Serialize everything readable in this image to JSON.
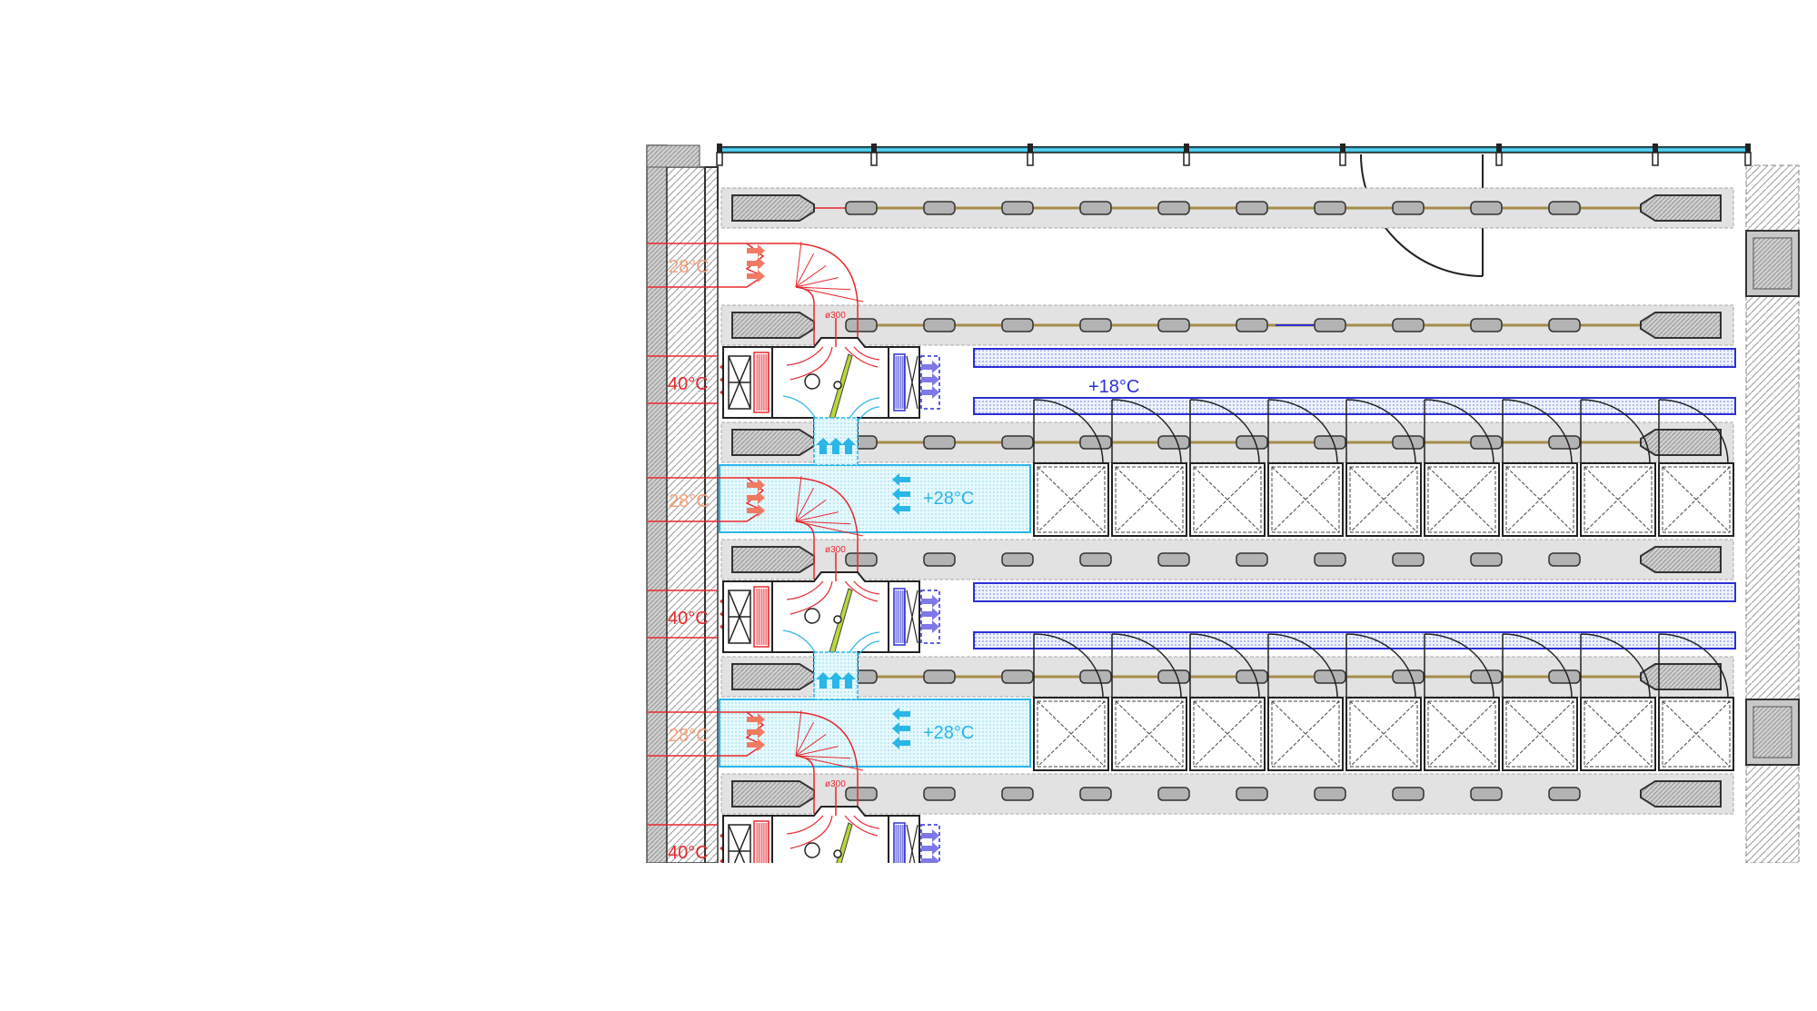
{
  "colors": {
    "hot": "#e8282d",
    "hot_light": "#f27a62",
    "warm": "#f2a07a",
    "cold": "#2b2fd6",
    "cyan": "#29b6e8",
    "cyan_fill": "#d8f4fb",
    "rack": "#e2e2e2",
    "lamp": "#b3b3b3",
    "cable": "#a58c4a",
    "window": "#5bd0ea",
    "fan": "#b8d83a"
  },
  "labels": {
    "intake_temp": "28°C",
    "exhaust_temp": "40°C",
    "supply_temp": "+18°C",
    "room_temp": "+28°C",
    "duct_diameter": "ø300"
  },
  "icons": {
    "arrow": "arrow-icon",
    "fan": "fan-icon",
    "heat_exchanger": "heat-exchanger-icon",
    "fan_coil": "fan-coil-icon",
    "door": "door-swing-icon"
  }
}
